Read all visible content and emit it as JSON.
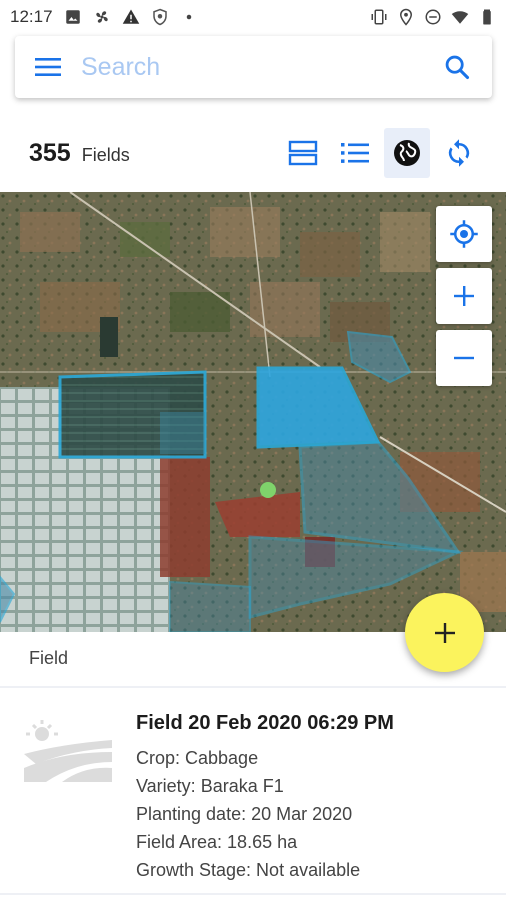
{
  "status_bar": {
    "time": "12:17",
    "left_icons": [
      "image-icon",
      "fan-icon",
      "warning-icon",
      "shield-icon",
      "dot-icon"
    ],
    "right_icons": [
      "vibrate-icon",
      "location-icon",
      "do-not-disturb-icon",
      "wifi-icon",
      "battery-icon"
    ]
  },
  "search": {
    "placeholder": "Search",
    "value": ""
  },
  "header": {
    "count": "355",
    "count_label": "Fields",
    "views": [
      {
        "name": "card-view-icon",
        "active": false
      },
      {
        "name": "list-view-icon",
        "active": false
      },
      {
        "name": "map-view-icon",
        "active": true
      },
      {
        "name": "sync-icon",
        "active": false
      }
    ]
  },
  "map": {
    "controls": [
      "my-location-icon",
      "zoom-in-icon",
      "zoom-out-icon"
    ],
    "field_outline_color": "#2aa7d6"
  },
  "fab": {
    "icon": "plus-icon",
    "color": "#fbf35d"
  },
  "section": {
    "label": "Field"
  },
  "field": {
    "title": "Field 20 Feb 2020 06:29 PM",
    "crop": "Crop: Cabbage",
    "variety": "Variety: Baraka F1",
    "planting_date": "Planting date: 20 Mar 2020",
    "area": "Field Area: 18.65 ha",
    "growth_stage": "Growth Stage: Not available"
  },
  "colors": {
    "accent": "#1a73e8",
    "placeholder": "#a9c8f2"
  }
}
